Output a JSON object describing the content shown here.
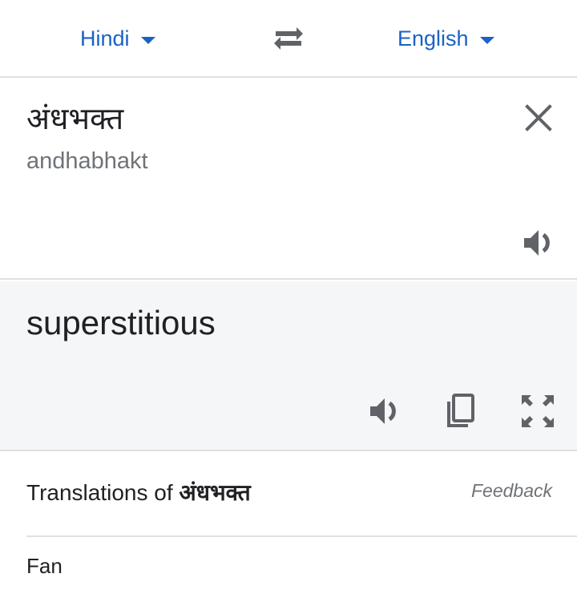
{
  "languages": {
    "source": "Hindi",
    "target": "English"
  },
  "input": {
    "text": "अंधभक्त",
    "transliteration": "andhabhakt"
  },
  "output": {
    "text": "superstitious"
  },
  "translations": {
    "prefix": "Translations of ",
    "word": "अंधभक्त",
    "feedback": "Feedback",
    "items": [
      "Fan"
    ]
  },
  "colors": {
    "accent": "#1a62c4",
    "icon": "#5f6368",
    "result_background": "#f5f6f8"
  },
  "icons": [
    "chevron-down-icon",
    "swap-icon",
    "close-icon",
    "speaker-icon",
    "copy-icon",
    "fullscreen-icon"
  ]
}
